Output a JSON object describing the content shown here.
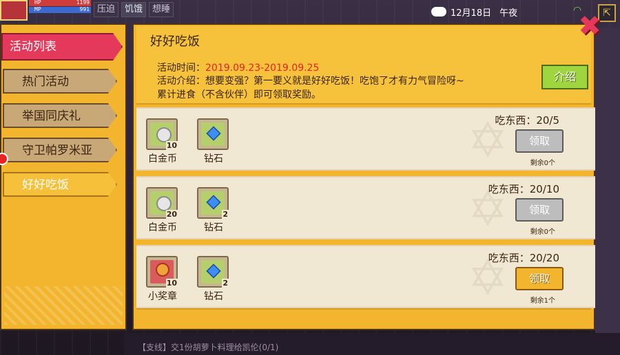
{
  "hud": {
    "hp_label": "HP",
    "hp_value": "1199",
    "mp_label": "MP",
    "mp_value": "991",
    "tags": [
      "压迫",
      "饥饿",
      "想睡"
    ],
    "date": "12月18日",
    "time_of_day": "午夜"
  },
  "sidebar": {
    "items": [
      {
        "label": "活动列表"
      },
      {
        "label": "热门活动"
      },
      {
        "label": "举国同庆礼"
      },
      {
        "label": "守卫帕罗米亚"
      },
      {
        "label": "好好吃饭"
      }
    ]
  },
  "activity": {
    "title": "好好吃饭",
    "time_label": "活动时间：",
    "time_value": "2019.09.23-2019.09.25",
    "desc_line1": "活动介绍：想要变强？第一要义就是好好吃饭！吃饱了才有力气冒险呀~",
    "desc_line2": "累计进食（不含伙伴）即可领取奖励。",
    "intro_button": "介绍"
  },
  "rewards": [
    {
      "items": [
        {
          "name": "白金币",
          "count": "10",
          "icon": "coin-icon"
        },
        {
          "name": "钻石",
          "count": "",
          "icon": "diamond-icon"
        }
      ],
      "progress": "吃东西：20/5",
      "button": "领取",
      "active": false,
      "remaining": "剩余0个"
    },
    {
      "items": [
        {
          "name": "白金币",
          "count": "20",
          "icon": "coin-icon"
        },
        {
          "name": "钻石",
          "count": "2",
          "icon": "diamond-icon"
        }
      ],
      "progress": "吃东西：20/10",
      "button": "领取",
      "active": false,
      "remaining": "剩余0个"
    },
    {
      "items": [
        {
          "name": "小奖章",
          "count": "10",
          "icon": "medal-icon"
        },
        {
          "name": "钻石",
          "count": "2",
          "icon": "diamond-icon"
        }
      ],
      "progress": "吃东西：20/20",
      "button": "领取",
      "active": true,
      "remaining": "剩余1个"
    }
  ],
  "quest": {
    "text": "【支线】交1份胡萝卜料理给凯伦(0/1)"
  },
  "colors": {
    "panel": "#f2b52d",
    "selected_tab": "#e5395c",
    "date_red": "#e3221c",
    "claim_active": "#f2b52d",
    "claim_disabled": "#bdbdbd"
  }
}
